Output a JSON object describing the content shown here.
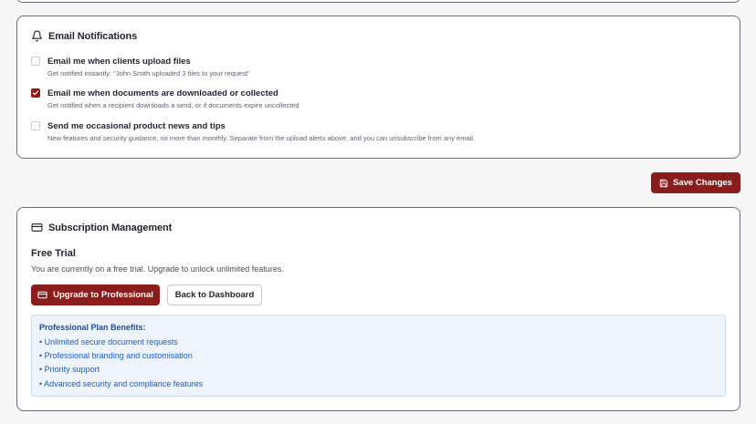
{
  "email_notifications": {
    "title": "Email Notifications",
    "options": [
      {
        "label": "Email me when clients upload files",
        "description": "Get notified instantly: \"John Smith uploaded 3 files to your request\"",
        "checked": false
      },
      {
        "label": "Email me when documents are downloaded or collected",
        "description": "Get notified when a recipient downloads a send, or if documents expire uncollected",
        "checked": true
      },
      {
        "label": "Send me occasional product news and tips",
        "description": "New features and security guidance, no more than monthly. Separate from the upload alerts above, and you can unsubscribe from any email.",
        "checked": false
      }
    ]
  },
  "save_button": {
    "label": "Save Changes"
  },
  "subscription": {
    "title": "Subscription Management",
    "plan_name": "Free Trial",
    "plan_description": "You are currently on a free trial. Upgrade to unlock unlimited features.",
    "upgrade_label": "Upgrade to Professional",
    "dashboard_label": "Back to Dashboard",
    "benefits_title": "Professional Plan Benefits:",
    "benefits": [
      "• Unlimited secure document requests",
      "• Professional branding and customisation",
      "• Priority support",
      "• Advanced security and compliance features"
    ]
  },
  "colors": {
    "primary": "#8a1c1c",
    "benefits_bg": "#eef4fc",
    "benefits_text": "#1d5bbf"
  },
  "icons": {
    "email_header": "bell-icon",
    "save": "save-disk-icon",
    "subscription_header": "credit-card-icon",
    "upgrade": "credit-card-icon"
  }
}
